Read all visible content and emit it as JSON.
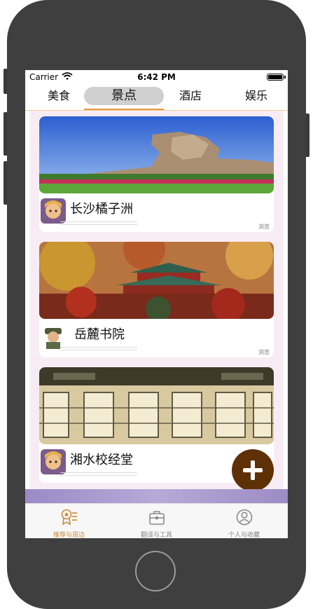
{
  "status_bar": {
    "carrier": "Carrier",
    "time": "6:42 PM"
  },
  "top_tabs": [
    {
      "label": "美食",
      "active": false
    },
    {
      "label": "景点",
      "active": true
    },
    {
      "label": "酒店",
      "active": false
    },
    {
      "label": "娱乐",
      "active": false
    }
  ],
  "cards": [
    {
      "title": "长沙橘子洲",
      "browse_label": "浏览"
    },
    {
      "title": "岳麓书院",
      "browse_label": "浏览"
    },
    {
      "title": "湘水校经堂",
      "browse_label": ""
    }
  ],
  "bottom_tabs": [
    {
      "label": "推荐与周边",
      "icon": "ribbon-list-icon",
      "active": true
    },
    {
      "label": "翻译与工具",
      "icon": "toolbox-icon",
      "active": false
    },
    {
      "label": "个人与收藏",
      "icon": "person-circle-icon",
      "active": false
    }
  ],
  "colors": {
    "accent": "#e49a3d",
    "fab": "#5e3006",
    "feed_bg": "#f8ecf4",
    "active_tab_label": "#c9893a"
  }
}
